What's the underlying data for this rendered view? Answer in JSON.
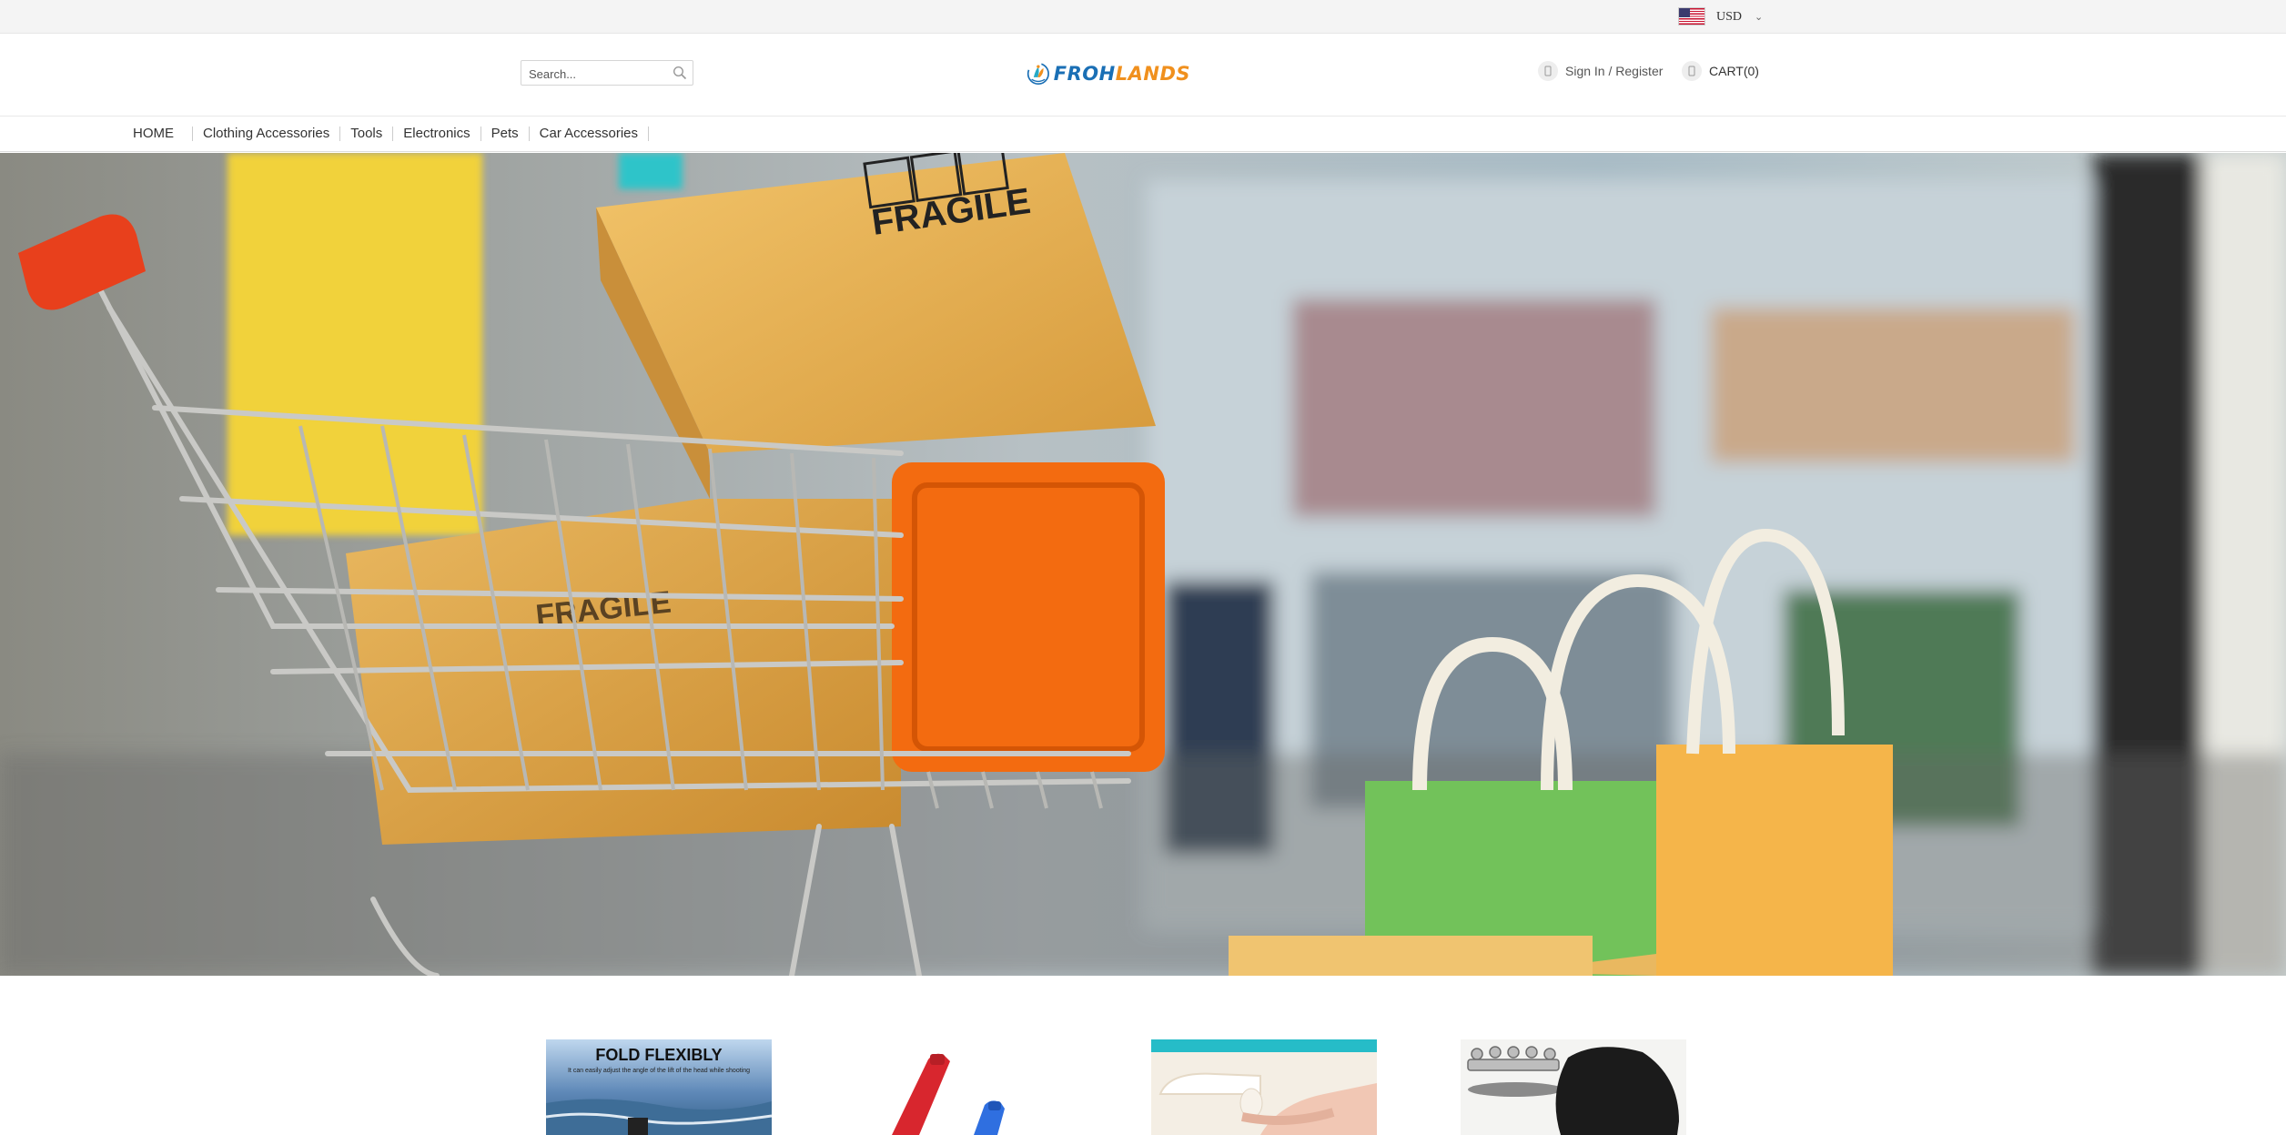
{
  "topbar": {
    "currency_flag_icon": "us-flag-icon",
    "currency_selected": "USD"
  },
  "header": {
    "search": {
      "placeholder": "Search..."
    },
    "logo": {
      "text_part1": "FROH",
      "text_part2": "LANDS"
    },
    "account": {
      "label": "Sign In / Register"
    },
    "cart": {
      "label": "CART(0)"
    }
  },
  "nav": {
    "items": [
      "HOME",
      "Clothing Accessories",
      "Tools",
      "Electronics",
      "Pets",
      "Car Accessories"
    ]
  },
  "hero": {
    "box_label": "FRAGILE",
    "box_label_partial": "FRAGILE"
  },
  "products": [
    {
      "banner_title": "FOLD FLEXIBLY",
      "banner_sub": "It can easily adjust the angle of the lift of the head while shooting"
    },
    {
      "banner_title": ""
    },
    {
      "banner_title": ""
    },
    {
      "banner_title": ""
    }
  ],
  "colors": {
    "brand_blue": "#1a6fb5",
    "brand_orange": "#f0901e",
    "topbar_bg": "#f4f4f4",
    "cyan_strip": "#26bcc8"
  }
}
